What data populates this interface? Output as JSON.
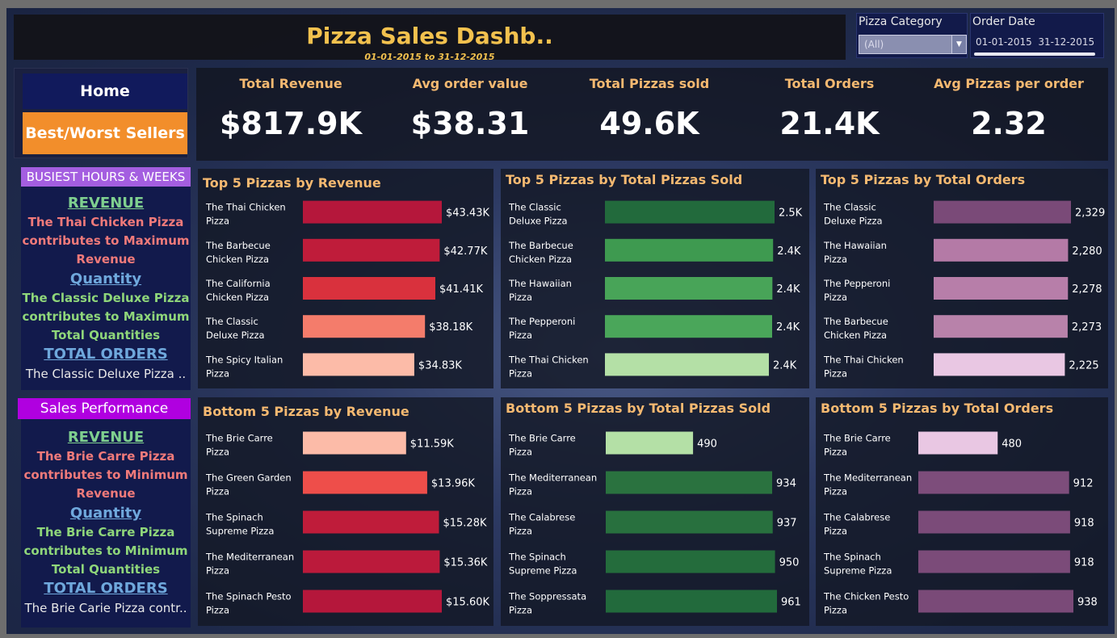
{
  "header": {
    "title": "Pizza Sales Dashb..",
    "date_range": "01-01-2015 to 31-12-2015"
  },
  "filters": {
    "pizza_category": {
      "label": "Pizza Category",
      "value": "(All)"
    },
    "order_date": {
      "label": "Order Date",
      "start": "01-01-2015",
      "end": "31-12-2015"
    }
  },
  "nav": {
    "home": "Home",
    "best_worst": "Best/Worst Sellers"
  },
  "kpis": [
    {
      "label": "Total Revenue",
      "value": "$817.9K"
    },
    {
      "label": "Avg order value",
      "value": "$38.31"
    },
    {
      "label": "Total Pizzas sold",
      "value": "49.6K"
    },
    {
      "label": "Total Orders",
      "value": "21.4K"
    },
    {
      "label": "Avg Pizzas per order",
      "value": "2.32"
    }
  ],
  "busiest": {
    "title": "BUSIEST HOURS & WEEKS",
    "lines": [
      "REVENUE",
      "The Thai Chicken Pizza",
      "contributes to Maximum",
      "Revenue",
      "Quantity",
      "The Classic Deluxe Pizza",
      "contributes to Maximum",
      "Total Quantities",
      "TOTAL ORDERS",
      "The Classic Deluxe Pizza .."
    ]
  },
  "sales_perf": {
    "title": "Sales Performance",
    "lines": [
      "REVENUE",
      "The Brie Carre Pizza",
      "contributes to Minimum",
      "Revenue",
      "Quantity",
      "The Brie Carre Pizza",
      "contributes to Minimum",
      "Total Quantities",
      "TOTAL ORDERS",
      "The Brie Carie Pizza contr.."
    ]
  },
  "colors": {
    "header_gold": "#f2c14e",
    "title_orange": "#f5b971",
    "nav_orange": "#f28e2b",
    "nav_blue": "#111a5c"
  },
  "chart_data": [
    {
      "type": "bar",
      "title": "Top 5 Pizzas by Revenue",
      "categories": [
        "The Thai Chicken Pizza",
        "The Barbecue Chicken Pizza",
        "The California Chicken Pizza",
        "The Classic Deluxe Pizza",
        "The Spicy Italian Pizza"
      ],
      "values": [
        43434,
        42768,
        41410,
        38180,
        34831
      ],
      "labels": [
        "$43.43K",
        "$42.77K",
        "$41.41K",
        "$38.18K",
        "$34.83K"
      ],
      "colors": [
        "#b5173b",
        "#bf1c3a",
        "#d9313d",
        "#f47c6b",
        "#fcbba8"
      ]
    },
    {
      "type": "bar",
      "title": "Top 5 Pizzas by Total Pizzas Sold",
      "categories": [
        "The Classic Deluxe Pizza",
        "The Barbecue Chicken Pizza",
        "The Hawaiian Pizza",
        "The Pepperoni Pizza",
        "The Thai Chicken Pizza"
      ],
      "values": [
        2453,
        2432,
        2422,
        2418,
        2371
      ],
      "labels": [
        "2.5K",
        "2.4K",
        "2.4K",
        "2.4K",
        "2.4K"
      ],
      "colors": [
        "#226a3c",
        "#3e9a50",
        "#48a458",
        "#4aa65a",
        "#b4e0a6"
      ]
    },
    {
      "type": "bar",
      "title": "Top 5 Pizzas by Total Orders",
      "categories": [
        "The Classic Deluxe Pizza",
        "The Hawaiian Pizza",
        "The Pepperoni Pizza",
        "The Barbecue Chicken Pizza",
        "The Thai Chicken Pizza"
      ],
      "values": [
        2329,
        2280,
        2278,
        2273,
        2225
      ],
      "labels": [
        "2,329",
        "2,280",
        "2,278",
        "2,273",
        "2,225"
      ],
      "colors": [
        "#7a4a78",
        "#b47aa6",
        "#b77ea9",
        "#b882aa",
        "#e9c7e3"
      ]
    },
    {
      "type": "bar",
      "title": "Bottom 5 Pizzas by Revenue",
      "categories": [
        "The Brie Carre Pizza",
        "The Green Garden Pizza",
        "The Spinach Supreme Pizza",
        "The Mediterranean Pizza",
        "The Spinach Pesto Pizza"
      ],
      "values": [
        11588,
        13956,
        15278,
        15360,
        15596
      ],
      "labels": [
        "$11.59K",
        "$13.96K",
        "$15.28K",
        "$15.36K",
        "$15.60K"
      ],
      "colors": [
        "#fcbba8",
        "#ee4e4a",
        "#bf1c3a",
        "#bb1a3b",
        "#b5173b"
      ]
    },
    {
      "type": "bar",
      "title": "Bottom 5 Pizzas by Total Pizzas Sold",
      "categories": [
        "The Brie Carre Pizza",
        "The Mediterranean Pizza",
        "The Calabrese Pizza",
        "The Spinach Supreme Pizza",
        "The Soppressata Pizza"
      ],
      "values": [
        490,
        934,
        937,
        950,
        961
      ],
      "labels": [
        "490",
        "934",
        "937",
        "950",
        "961"
      ],
      "colors": [
        "#b4e0a6",
        "#2a723f",
        "#28703e",
        "#246c3c",
        "#226a3c"
      ]
    },
    {
      "type": "bar",
      "title": "Bottom 5 Pizzas by Total Orders",
      "categories": [
        "The Brie Carre Pizza",
        "The Mediterranean Pizza",
        "The Calabrese Pizza",
        "The Spinach Supreme Pizza",
        "The Chicken Pesto Pizza"
      ],
      "values": [
        480,
        912,
        918,
        918,
        938
      ],
      "labels": [
        "480",
        "912",
        "918",
        "918",
        "938"
      ],
      "colors": [
        "#e9c7e3",
        "#7d4d7b",
        "#7b4b79",
        "#7b4b79",
        "#7a4a78"
      ]
    }
  ]
}
